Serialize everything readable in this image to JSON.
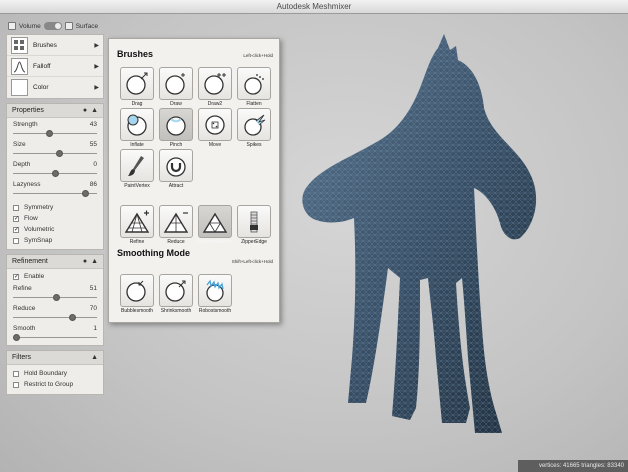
{
  "window": {
    "title": "Autodesk Meshmixer"
  },
  "mode": {
    "volume_label": "Volume",
    "surface_label": "Surface"
  },
  "tools": [
    {
      "label": "Brushes"
    },
    {
      "label": "Falloff"
    },
    {
      "label": "Color"
    }
  ],
  "properties": {
    "title": "Properties",
    "sliders": [
      {
        "label": "Strength",
        "value": "43",
        "fraction": 0.43
      },
      {
        "label": "Size",
        "value": "55",
        "fraction": 0.55
      },
      {
        "label": "Depth",
        "value": "0",
        "fraction": 0.5
      },
      {
        "label": "Lazyness",
        "value": "86",
        "fraction": 0.86
      }
    ],
    "checks": [
      {
        "label": "Symmetry",
        "checked": false
      },
      {
        "label": "Flow",
        "checked": true
      },
      {
        "label": "Volumetric",
        "checked": true
      },
      {
        "label": "SymSnap",
        "checked": false
      }
    ]
  },
  "refinement": {
    "title": "Refinement",
    "enable_label": "Enable",
    "enable_checked": true,
    "sliders": [
      {
        "label": "Refine",
        "value": "51",
        "fraction": 0.51
      },
      {
        "label": "Reduce",
        "value": "70",
        "fraction": 0.7
      },
      {
        "label": "Smooth",
        "value": "1",
        "fraction": 0.01
      }
    ]
  },
  "filters": {
    "title": "Filters",
    "checks": [
      {
        "label": "Hold Boundary",
        "checked": false
      },
      {
        "label": "Restrict to Group",
        "checked": false
      }
    ]
  },
  "brushes_popup": {
    "title": "Brushes",
    "hint": "Left-click+Hold",
    "brushes": [
      {
        "label": "Drag",
        "selected": false
      },
      {
        "label": "Draw",
        "selected": false
      },
      {
        "label": "Draw2",
        "selected": false
      },
      {
        "label": "Flatten",
        "selected": false
      },
      {
        "label": "Inflate",
        "selected": false
      },
      {
        "label": "Pinch",
        "selected": true
      },
      {
        "label": "Move",
        "selected": false
      },
      {
        "label": "Spikes",
        "selected": false
      },
      {
        "label": "PaintVertex",
        "selected": false
      },
      {
        "label": "Attract",
        "selected": false
      },
      {
        "label": "Refine",
        "selected": false
      },
      {
        "label": "Reduce",
        "selected": false
      },
      {
        "label": "AdaptiveReduce",
        "selected": true
      },
      {
        "label": "ZipperEdge",
        "selected": false
      }
    ],
    "smoothing_title": "Smoothing Mode",
    "smoothing_hint": "Shift+Left-click+Hold",
    "smoothing": [
      {
        "label": "Bubblesmooth"
      },
      {
        "label": "Shrinksmooth"
      },
      {
        "label": "Robostsmooth"
      }
    ]
  },
  "status": {
    "text": "vertices: 41665 triangles: 83340"
  },
  "colors": {
    "mesh": "#3f5a73",
    "panel": "#efedea",
    "viewport": "#c4c4c4"
  }
}
